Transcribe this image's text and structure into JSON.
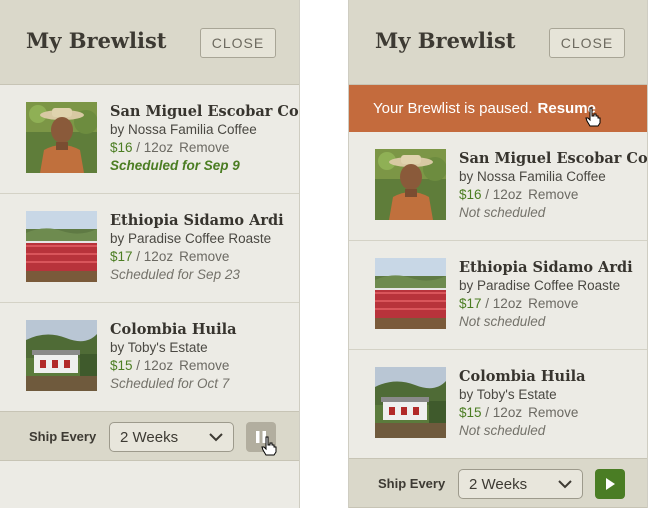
{
  "left": {
    "title": "My Brewlist",
    "close_label": "CLOSE",
    "items": [
      {
        "name": "San Miguel Escobar Co",
        "by": "by Nossa Familia Coffee",
        "price": "$16",
        "size": "/ 12oz",
        "remove": "Remove",
        "schedule": "Scheduled for Sep 9"
      },
      {
        "name": "Ethiopia Sidamo Ardi",
        "by": "by Paradise Coffee Roaste",
        "price": "$17",
        "size": "/ 12oz",
        "remove": "Remove",
        "schedule": "Scheduled for Sep 23"
      },
      {
        "name": "Colombia Huila",
        "by": "by Toby's Estate",
        "price": "$15",
        "size": "/ 12oz",
        "remove": "Remove",
        "schedule": "Scheduled for Oct 7"
      }
    ],
    "ship_every_label": "Ship Every",
    "frequency": "2 Weeks"
  },
  "right": {
    "title": "My Brewlist",
    "close_label": "CLOSE",
    "banner_text": "Your Brewlist is paused.",
    "resume_label": "Resume",
    "items": [
      {
        "name": "San Miguel Escobar Co",
        "by": "by Nossa Familia Coffee",
        "price": "$16",
        "size": "/ 12oz",
        "remove": "Remove",
        "schedule": "Not scheduled"
      },
      {
        "name": "Ethiopia Sidamo Ardi",
        "by": "by Paradise Coffee Roaste",
        "price": "$17",
        "size": "/ 12oz",
        "remove": "Remove",
        "schedule": "Not scheduled"
      },
      {
        "name": "Colombia Huila",
        "by": "by Toby's Estate",
        "price": "$15",
        "size": "/ 12oz",
        "remove": "Remove",
        "schedule": "Not scheduled"
      }
    ],
    "ship_every_label": "Ship Every",
    "frequency": "2 Weeks"
  },
  "colors": {
    "accent_green": "#4b7d22",
    "banner_orange": "#c46b3d",
    "header_bg": "#dad8ca",
    "panel_bg": "#ecebe5"
  },
  "icons": {
    "pause": "pause-icon",
    "play": "play-icon",
    "chevron": "chevron-down-icon",
    "cursor": "hand-cursor-icon"
  }
}
